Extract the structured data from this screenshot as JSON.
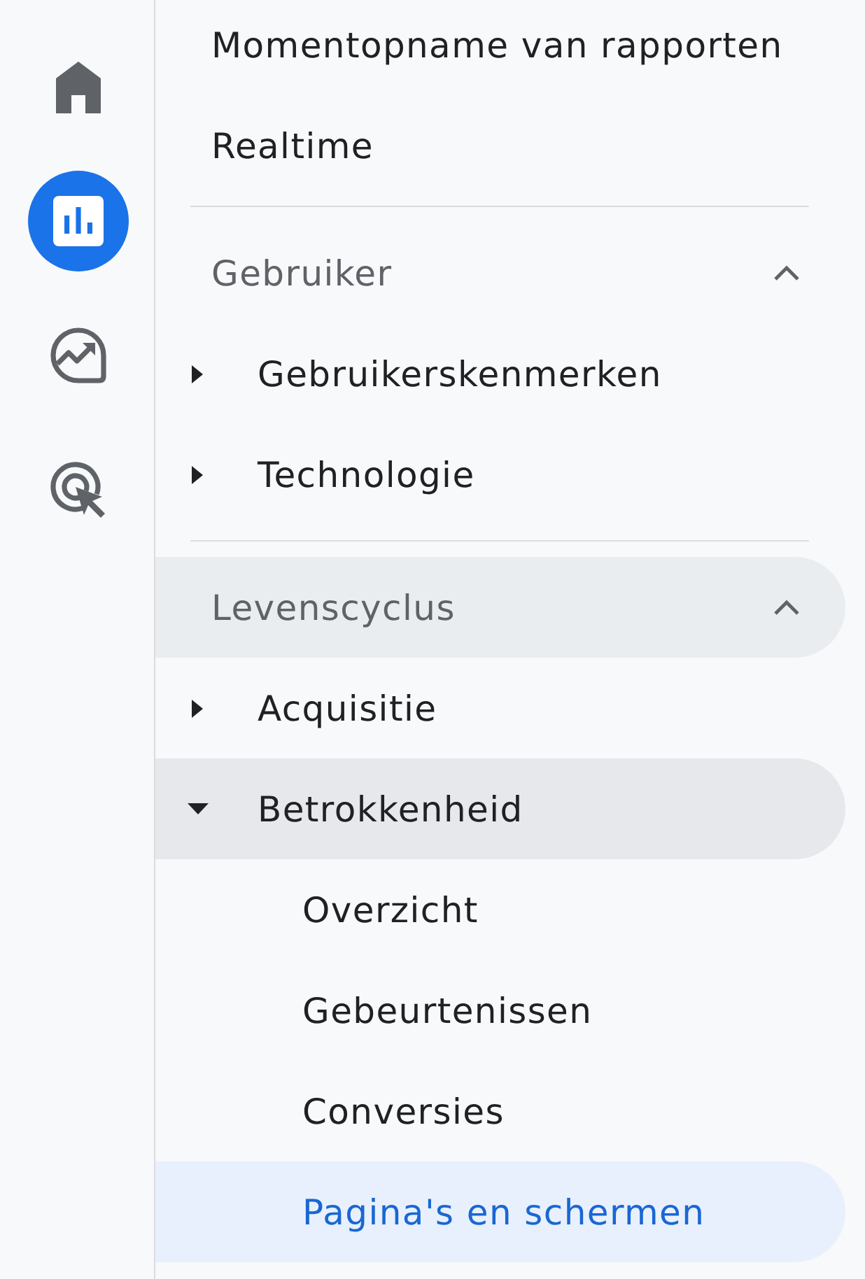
{
  "rail": {
    "items": [
      {
        "kind": "home",
        "selected": false
      },
      {
        "kind": "chart",
        "selected": true
      },
      {
        "kind": "trend",
        "selected": false
      },
      {
        "kind": "target",
        "selected": false
      }
    ]
  },
  "nav": {
    "top_items": [
      {
        "label": "Momentopname van rapporten",
        "selected": false
      },
      {
        "label": "Realtime",
        "selected": false
      }
    ],
    "sections": [
      {
        "title": "Gebruiker",
        "expanded": true,
        "highlighted": false,
        "items": [
          {
            "label": "Gebruikerskenmerken",
            "expanded": false,
            "highlighted": false
          },
          {
            "label": "Technologie",
            "expanded": false,
            "highlighted": false
          }
        ]
      },
      {
        "title": "Levenscyclus",
        "expanded": true,
        "highlighted": true,
        "items": [
          {
            "label": "Acquisitie",
            "expanded": false,
            "highlighted": false
          },
          {
            "label": "Betrokkenheid",
            "expanded": true,
            "highlighted": true,
            "children": [
              {
                "label": "Overzicht",
                "selected": false
              },
              {
                "label": "Gebeurtenissen",
                "selected": false
              },
              {
                "label": "Conversies",
                "selected": false
              },
              {
                "label": "Pagina's en schermen",
                "selected": true
              }
            ]
          }
        ]
      }
    ]
  }
}
